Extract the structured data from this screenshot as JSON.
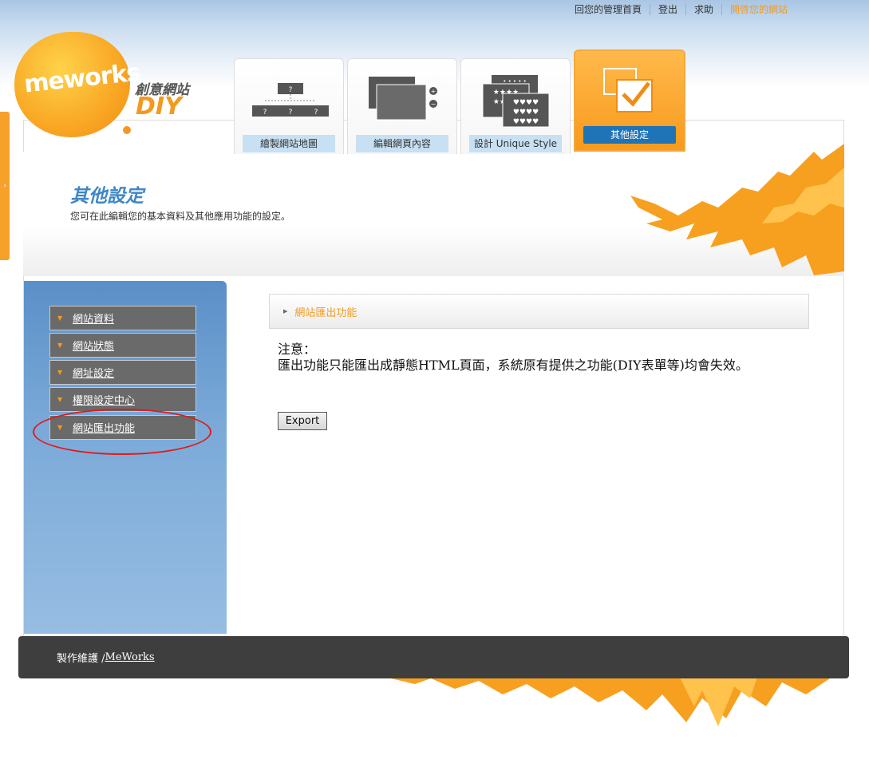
{
  "top_nav": {
    "items": [
      {
        "label": "回您的管理首頁"
      },
      {
        "label": "登出"
      },
      {
        "label": "求助"
      },
      {
        "label": "開啓您的網站"
      }
    ]
  },
  "logo": {
    "brand": "meworks",
    "subtitle": "創意網站",
    "diy": "DIY"
  },
  "tabs": [
    {
      "label": "繪製網站地圖",
      "icon": "sitemap-icon"
    },
    {
      "label": "編輯網頁內容",
      "icon": "pages-icon"
    },
    {
      "label": "設計 Unique Style",
      "icon": "style-icon"
    },
    {
      "label": "其他設定",
      "icon": "checkbox-icon",
      "active": true
    }
  ],
  "header": {
    "title": "其他設定",
    "description": "您可在此編輯您的基本資料及其他應用功能的設定。"
  },
  "sidebar": {
    "items": [
      {
        "label": "網站資料"
      },
      {
        "label": "網站狀態"
      },
      {
        "label": "網址設定"
      },
      {
        "label": "權限設定中心"
      },
      {
        "label": "網站匯出功能"
      }
    ]
  },
  "content": {
    "section_title": "網站匯出功能",
    "notice_heading": "注意：",
    "notice_body": "匯出功能只能匯出成靜態HTML頁面，系統原有提供之功能(DIY表單等)均會失效。",
    "export_label": "Export"
  },
  "footer": {
    "prefix": "製作維護 / ",
    "link": "MeWorks"
  },
  "colors": {
    "accent": "#f39a1e",
    "title_blue": "#3f87c6",
    "tab_active_label": "#1f73b7",
    "footer_bg": "#3e3e3e",
    "highlight": "#e21a1a"
  }
}
